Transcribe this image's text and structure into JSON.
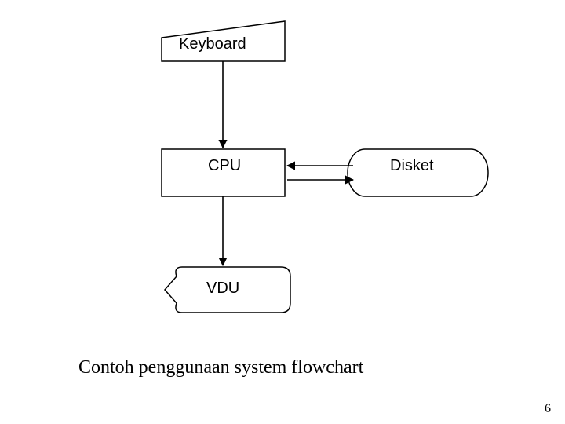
{
  "nodes": {
    "keyboard": {
      "label": "Keyboard"
    },
    "cpu": {
      "label": "CPU"
    },
    "disket": {
      "label": "Disket"
    },
    "vdu": {
      "label": "VDU"
    }
  },
  "caption": "Contoh penggunaan system flowchart",
  "page_number": "6"
}
